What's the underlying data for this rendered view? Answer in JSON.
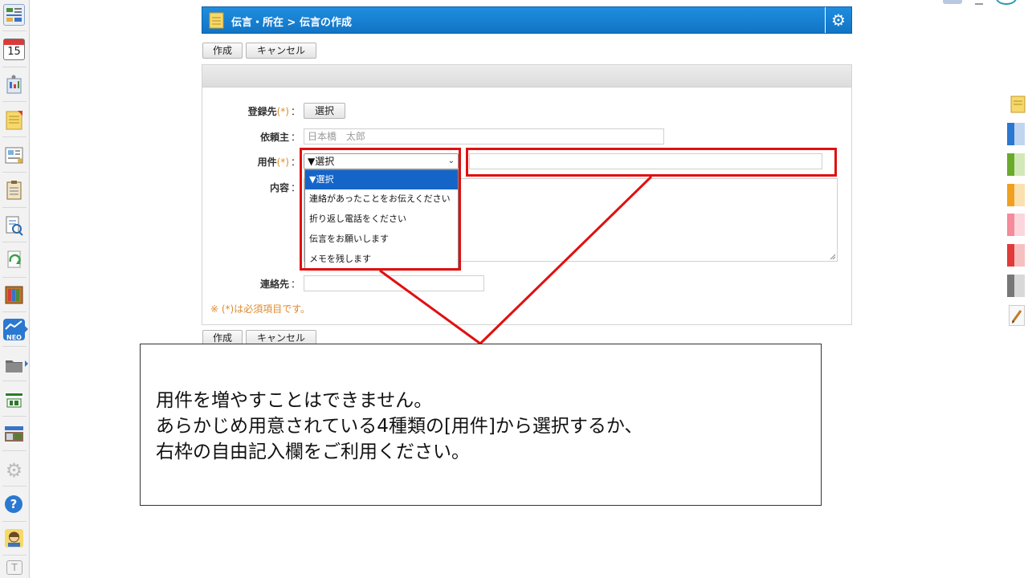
{
  "breadcrumb": {
    "text": "伝言・所在 > 伝言の作成"
  },
  "toolbar_top": {
    "create_label": "作成",
    "cancel_label": "キャンセル"
  },
  "toolbar_bottom": {
    "create_label": "作成",
    "cancel_label": "キャンセル"
  },
  "form": {
    "recipient": {
      "label": "登録先",
      "required_mark": "(*)",
      "colon": "：",
      "button_label": "選択"
    },
    "requester": {
      "label": "依頼主",
      "colon": "：",
      "value": "日本橋　太郎"
    },
    "subject": {
      "label": "用件",
      "required_mark": "(*)",
      "colon": "：",
      "selected": "▼選択",
      "options": [
        "▼選択",
        "連絡があったことをお伝えください",
        "折り返し電話をください",
        "伝言をお願いします",
        "メモを残します"
      ],
      "free_text_value": ""
    },
    "content": {
      "label": "内容",
      "colon": "："
    },
    "contact": {
      "label": "連絡先",
      "colon": "：",
      "value": ""
    },
    "required_note": "※ (*)は必須項目です。"
  },
  "callout": {
    "lines": [
      "用件を増やすことはできません。",
      "あらかじめ用意されている4種類の[用件]から選択するか、",
      "右枠の自由記入欄をご利用ください。"
    ]
  },
  "sidebar": {
    "items": [
      {
        "icon": "portal-icon"
      },
      {
        "icon": "calendar-icon",
        "text": "15"
      },
      {
        "icon": "facility-icon"
      },
      {
        "icon": "memo-icon"
      },
      {
        "icon": "bulletin-icon"
      },
      {
        "icon": "clipboard-icon"
      },
      {
        "icon": "document-search-icon"
      },
      {
        "icon": "recycle-icon"
      },
      {
        "icon": "cabinet-icon"
      },
      {
        "icon": "neo-icon",
        "text": "NEO"
      },
      {
        "icon": "folder-icon"
      },
      {
        "icon": "app-banner-icon"
      },
      {
        "icon": "app-banner-2-icon"
      },
      {
        "icon": "settings-icon"
      },
      {
        "icon": "help-icon",
        "text": "?"
      },
      {
        "icon": "support-icon"
      },
      {
        "icon": "text-icon",
        "text": "T"
      }
    ]
  },
  "colors": {
    "titlebar": "#1a82d6",
    "highlight": "#e01010",
    "required": "#e08a2c",
    "selection": "#1565c9"
  }
}
